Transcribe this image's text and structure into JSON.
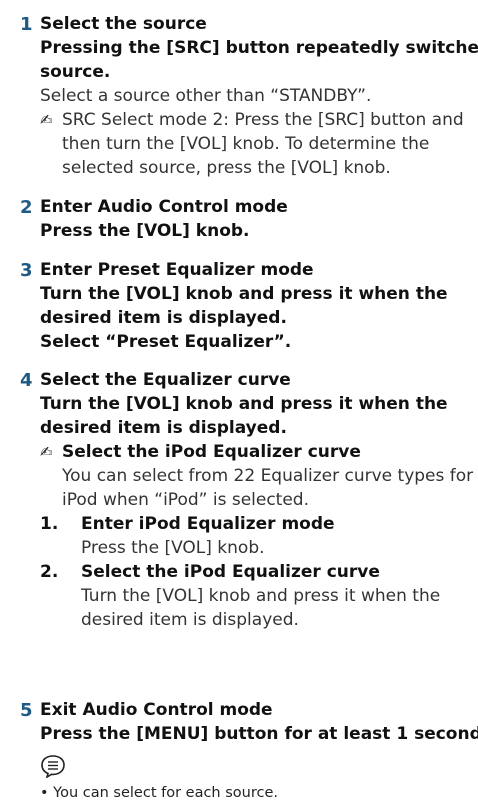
{
  "steps": [
    {
      "number": "1",
      "title": "Select the source",
      "bold_lines": [
        "Pressing the [SRC] button repeatedly switches",
        "source."
      ],
      "text": "Select a source other than “STANDBY”.",
      "note_lines": [
        "SRC Select mode 2: Press the [SRC] button and",
        "then turn the [VOL] knob. To determine the",
        "selected source, press the [VOL] knob."
      ]
    },
    {
      "number": "2",
      "title": "Enter Audio Control mode",
      "bold_lines": [
        "Press the [VOL] knob."
      ]
    },
    {
      "number": "3",
      "title": "Enter Preset Equalizer mode",
      "bold_lines": [
        "Turn the [VOL] knob and press it when the",
        "desired item is displayed.",
        "Select “Preset Equalizer”."
      ]
    },
    {
      "number": "4",
      "title": "Select the Equalizer curve",
      "bold_lines": [
        "Turn the [VOL] knob and press it when the",
        "desired item is displayed."
      ],
      "note_title": "Select the iPod Equalizer curve",
      "note_text_lines": [
        "You can select from 22 Equalizer curve types for",
        "iPod when “iPod” is selected."
      ],
      "substeps": [
        {
          "number": "1.",
          "title": "Enter iPod Equalizer mode",
          "lines": [
            "Press the [VOL] knob."
          ]
        },
        {
          "number": "2.",
          "title": "Select the iPod Equalizer curve",
          "lines": [
            "Turn the [VOL] knob and press it when the",
            "desired item is displayed."
          ]
        }
      ]
    },
    {
      "number": "5",
      "title": "Exit Audio Control mode",
      "bold_lines": [
        "Press the [MENU] button for at least 1 second."
      ]
    }
  ],
  "memo": {
    "icon": "memo-icon",
    "bullet": "• You can select for each source."
  }
}
